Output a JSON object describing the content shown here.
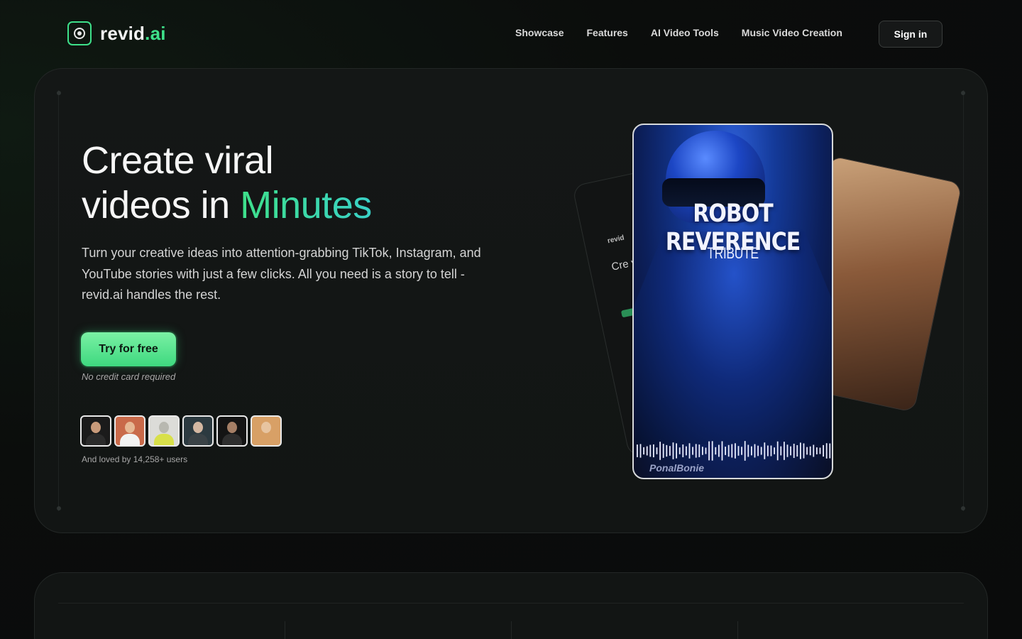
{
  "brand": {
    "name_a": "revid",
    "name_b": ".ai",
    "logo_icon": "camera-lens-icon",
    "accent": "#3ee08a"
  },
  "nav": {
    "links": [
      "Showcase",
      "Features",
      "AI Video Tools",
      "Music Video Creation"
    ],
    "sign_in": "Sign in"
  },
  "hero": {
    "headline_line1": "Create viral",
    "headline_line2_plain": "videos in ",
    "headline_line2_accent": "Minutes",
    "subtext": "Turn your creative ideas into attention-grabbing TikTok, Instagram, and YouTube stories with just a few clicks. All you need is a story to tell - revid.ai handles the rest.",
    "cta": "Try for free",
    "cta_note": "No credit card required",
    "social_proof": "And loved by 14,258+ users",
    "avatars": [
      {
        "name": "user-avatar-1",
        "bg": "#1b1b1b",
        "skin": "#c89a7a",
        "shirt": "#2b2b2b"
      },
      {
        "name": "user-avatar-2",
        "bg": "#c96a4a",
        "skin": "#e6b894",
        "shirt": "#f2f2f2"
      },
      {
        "name": "user-avatar-3",
        "bg": "#dcdcd8",
        "skin": "#b8b8b0",
        "shirt": "#d8e04a"
      },
      {
        "name": "user-avatar-4",
        "bg": "#2c3a40",
        "skin": "#d4b8a2",
        "shirt": "#3a4246"
      },
      {
        "name": "user-avatar-5",
        "bg": "#141414",
        "skin": "#a57f66",
        "shirt": "#2e2e2e"
      },
      {
        "name": "user-avatar-6",
        "bg": "#d8a066",
        "skin": "#e7c4a0",
        "shirt": "#d8a066"
      }
    ]
  },
  "showcase": {
    "main_title": "ROBOT REVERENCE",
    "main_subtitle": "TRIBUTE",
    "main_brand": "PonalBonie",
    "left_card_brand": "revid",
    "left_card_title": "Cre vid"
  }
}
